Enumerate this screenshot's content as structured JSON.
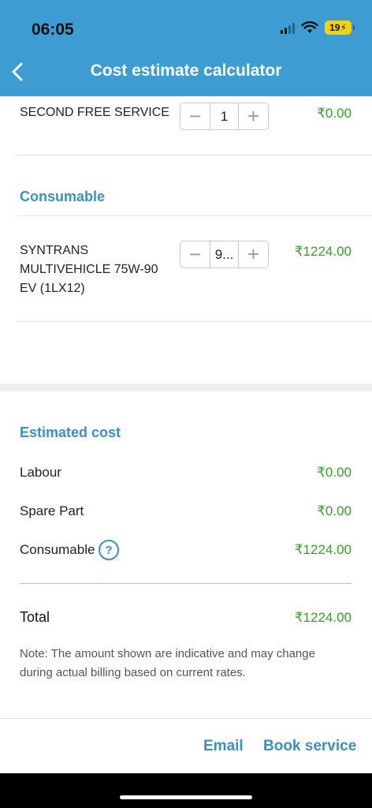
{
  "status_bar": {
    "time": "06:05",
    "battery": "19"
  },
  "header": {
    "title": "Cost estimate calculator"
  },
  "items_top": [
    {
      "name": "SECOND FREE SERVICE",
      "qty": "1",
      "price": "₹0.00"
    }
  ],
  "consumable_section": {
    "title": "Consumable",
    "items": [
      {
        "name": "SYNTRANS MULTIVEHICLE 75W-90 EV (1LX12)",
        "qty": "9...",
        "price": "₹1224.00"
      }
    ]
  },
  "estimate": {
    "title": "Estimated cost",
    "rows": [
      {
        "label": "Labour",
        "value": "₹0.00"
      },
      {
        "label": "Spare Part",
        "value": "₹0.00"
      },
      {
        "label": "Consumable",
        "value": "₹1224.00",
        "help_symbol": "?"
      }
    ],
    "total_label": "Total",
    "total_value": "₹1224.00",
    "note": "Note: The amount shown are indicative and may change during actual billing based on current rates."
  },
  "footer": {
    "email_label": "Email",
    "book_label": "Book service"
  },
  "colors": {
    "header_bg": "#3d9cd2",
    "accent": "#3d8fc0",
    "price_green": "#3a9c2f"
  }
}
